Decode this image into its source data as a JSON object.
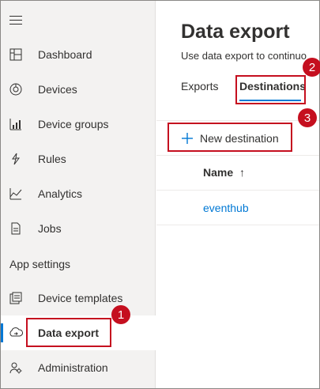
{
  "sidebar": {
    "items": [
      {
        "label": "Dashboard",
        "icon": "dashboard-icon"
      },
      {
        "label": "Devices",
        "icon": "devices-icon"
      },
      {
        "label": "Device groups",
        "icon": "device-groups-icon"
      },
      {
        "label": "Rules",
        "icon": "rules-icon"
      },
      {
        "label": "Analytics",
        "icon": "analytics-icon"
      },
      {
        "label": "Jobs",
        "icon": "jobs-icon"
      }
    ],
    "section_heading": "App settings",
    "settings_items": [
      {
        "label": "Device templates",
        "icon": "device-templates-icon"
      },
      {
        "label": "Data export",
        "icon": "data-export-icon",
        "selected": true
      },
      {
        "label": "Administration",
        "icon": "administration-icon"
      }
    ]
  },
  "main": {
    "title": "Data export",
    "description": "Use data export to continuo",
    "tabs": [
      {
        "label": "Exports",
        "active": false
      },
      {
        "label": "Destinations",
        "active": true
      }
    ],
    "toolbar": {
      "new_destination_label": "New destination"
    },
    "table": {
      "column_header": "Name",
      "sort_indicator": "↑",
      "rows": [
        {
          "name": "eventhub"
        }
      ]
    }
  },
  "annotations": {
    "badges": [
      "1",
      "2",
      "3"
    ]
  },
  "colors": {
    "accent": "#0078d4",
    "callout": "#c50f1f",
    "sidebar_bg": "#f3f2f1"
  }
}
